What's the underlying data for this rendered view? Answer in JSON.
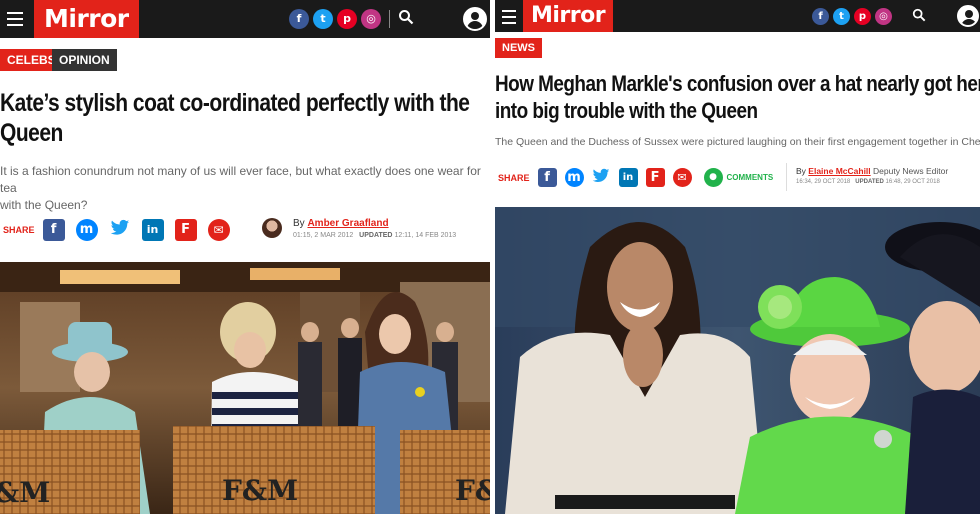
{
  "left": {
    "brand": "Mirror",
    "tags": [
      {
        "label": "CELEBS",
        "color": "#e2231a"
      },
      {
        "label": "OPINION",
        "color": "#333333"
      }
    ],
    "headline_line1": "Kate’s stylish coat co-ordinated perfectly with the",
    "headline_line2": "Queen",
    "standfirst_line1": "It is a fashion conundrum not many of us will ever face, but what exactly does one wear for tea",
    "standfirst_line2": "with the Queen?",
    "share_label": "SHARE",
    "byline_prefix": "By",
    "author": "Amber Graafland",
    "published": "01:15, 2 MAR 2012",
    "updated_label": "UPDATED",
    "updated": "12:11, 14 FEB 2013",
    "photo_caption_text_a": "F&M",
    "photo_caption_text_b": "&M",
    "photo_caption_text_c": "F&"
  },
  "right": {
    "brand": "Mirror",
    "tag": {
      "label": "NEWS",
      "color": "#e2231a"
    },
    "headline_line1": "How Meghan Markle's confusion over a hat nearly got her",
    "headline_line2": "into big trouble with the Queen",
    "standfirst": "The Queen and the Duchess of Sussex were pictured laughing on their first engagement together in Chester",
    "share_label": "SHARE",
    "comments_label": "COMMENTS",
    "byline_prefix": "By",
    "author": "Elaine McCahill",
    "role": "Deputy News Editor",
    "published": "16:34, 29 OCT 2018",
    "updated_label": "UPDATED",
    "updated": "16:48, 29 OCT 2018"
  },
  "icons": {
    "facebook": "f",
    "twitter": "t",
    "pinterest": "p",
    "instagram": "◎",
    "linkedin": "in",
    "flipboard": "F",
    "email": "✉",
    "messenger": "m",
    "search": "⚲",
    "comment": "💬"
  },
  "colors": {
    "brand_red": "#e2231a",
    "facebook": "#3b5998",
    "twitter": "#1da1f2",
    "pinterest": "#e60023",
    "instagram": "#c13584",
    "linkedin": "#0077b5",
    "messenger": "#0084ff",
    "comments": "#21b24b"
  }
}
